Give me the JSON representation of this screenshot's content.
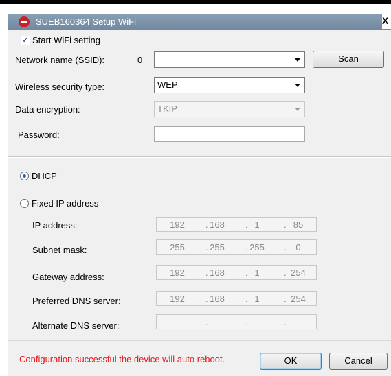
{
  "window": {
    "title": "SUEB160364  Setup WiFi",
    "close_label": "X"
  },
  "wifi": {
    "enable_label": "Start WiFi setting",
    "enable_checked": true,
    "ssid_label": "Network name (SSID):",
    "ssid_count": "0",
    "ssid_value": "",
    "scan_label": "Scan",
    "security_label": "Wireless security type:",
    "security_value": "WEP",
    "encryption_label": "Data encryption:",
    "encryption_value": "TKIP",
    "password_label": "Password:",
    "password_value": ""
  },
  "network": {
    "dhcp_label": "DHCP",
    "dhcp_selected": true,
    "fixed_label": "Fixed IP address",
    "fixed_selected": false,
    "ip_label": "IP address:",
    "ip": [
      "192",
      "168",
      "1",
      "85"
    ],
    "subnet_label": "Subnet mask:",
    "subnet": [
      "255",
      "255",
      "255",
      "0"
    ],
    "gateway_label": "Gateway address:",
    "gateway": [
      "192",
      "168",
      "1",
      "254"
    ],
    "dns1_label": "Preferred DNS server:",
    "dns1": [
      "192",
      "168",
      "1",
      "254"
    ],
    "dns2_label": "Alternate DNS server:",
    "dns2": [
      "",
      "",
      "",
      ""
    ]
  },
  "footer": {
    "status_message": "Configuration successful,the device will auto reboot.",
    "status_color": "#e81818",
    "ok_label": "OK",
    "cancel_label": "Cancel"
  }
}
